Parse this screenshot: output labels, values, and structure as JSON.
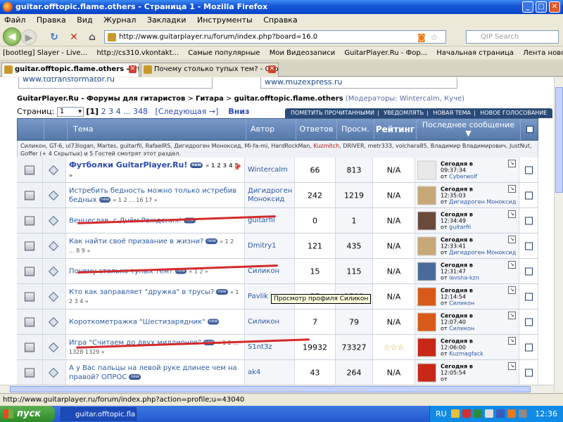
{
  "window": {
    "title": "guitar.offtopic.flame.others - Страница 1 - Mozilla Firefox"
  },
  "menu": [
    "Файл",
    "Правка",
    "Вид",
    "Журнал",
    "Закладки",
    "Инструменты",
    "Справка"
  ],
  "nav": {
    "url": "http://www.guitarplayer.ru/forum/index.php?board=16.0",
    "search_placeholder": "QIP Search"
  },
  "bookmarks": [
    "[bootleg] Slayer - Live...",
    "http://cs310.vkontakt...",
    "Самые популярные",
    "Мои Видеозаписи",
    "GuitarPlayer.Ru - Фор...",
    "Начальная страница",
    "Лента новостей"
  ],
  "tabs": [
    {
      "label": "guitar.offtopic.flame.others - Стр..."
    },
    {
      "label": "Почему столько тупых тем? - Страни..."
    }
  ],
  "ads": {
    "left": "www.tdtransformator.ru",
    "right": "www.muzexpress.ru"
  },
  "breadcrumb": {
    "site": "GuitarPlayer.Ru - Форумы для гитаристов",
    "sep1": " > ",
    "cat": "Гитара",
    "sep2": " > ",
    "board": "guitar.offtopic.flame.others",
    "mods_label": "(Модераторы:",
    "mods": "Wintercalm, Куче)"
  },
  "pager": {
    "label": "Страниц:",
    "select_value": "1",
    "current": "[1]",
    "pages": "2 3 4 ... 348",
    "next": "[Следующая →]",
    "bottom": "Вниз"
  },
  "actions": [
    "ПОМЕТИТЬ ПРОЧИТАННЫМИ",
    "УВЕДОМЛЯТЬ",
    "НОВАЯ ТЕМА",
    "НОВОЕ ГОЛОСОВАНИЕ"
  ],
  "table": {
    "headers": {
      "topic": "Тема",
      "author": "Автор",
      "replies": "Ответов",
      "views": "Просм.",
      "rating": "Рейтинг",
      "last": "Последнее сообщение"
    },
    "whoonline": {
      "text1": "Силикон, GT-6, ul73logan, Martes, guitarfil, RafaelRS, Дигидроген Моноксид, Mi-fa-mi, HardRockMan, ",
      "highlight": "Kuzmitch",
      "text2": ", DRIVER, metr333, volchara85, Владимир Владимирович, JustNut, Goffer (+ 4 Скрытых) и 5 Гостей смотрят этот раздел."
    },
    "rows": [
      {
        "topic": "Футболки GuitarPlayer.Ru!",
        "bold": true,
        "pages": "« 1 2 3 4 5 »",
        "author": "Wintercalm",
        "replies": "66",
        "views": "813",
        "rating": "N/A",
        "last_date": "Сегодня в",
        "last_time": "09:37:34",
        "last_from": "от",
        "last_user": "Cyberwolf",
        "avatar_color": "#e8e8e8"
      },
      {
        "topic": "Истребить бедность можно только истребив бедных",
        "bold": false,
        "pages": "« 1 2 ... 16 17 »",
        "author": "Дигидроген Моноксид",
        "replies": "242",
        "views": "1219",
        "rating": "N/A",
        "last_date": "Сегодня в",
        "last_time": "12:35:03",
        "last_from": "от",
        "last_user": "Дигидроген Моноксид",
        "avatar_color": "#c8a878"
      },
      {
        "topic": "Венцеслав, с Днём Рождения!",
        "bold": false,
        "pages": "",
        "author": "guitarfil",
        "replies": "0",
        "views": "1",
        "rating": "N/A",
        "last_date": "Сегодня в",
        "last_time": "12:34:49",
        "last_from": "от",
        "last_user": "guitarfil",
        "avatar_color": "#6a4a3a"
      },
      {
        "topic": "Как найти своё призвание в жизни?",
        "bold": false,
        "pages": "« 1 2 ... 8 9 »",
        "author": "Dmitry1",
        "replies": "121",
        "views": "435",
        "rating": "N/A",
        "last_date": "Сегодня в",
        "last_time": "12:33:41",
        "last_from": "от",
        "last_user": "Дигидроген Моноксид",
        "avatar_color": "#c8a878"
      },
      {
        "topic": "Почему столько тупых тем?",
        "bold": false,
        "pages": "« 1 2 »",
        "author": "Силикон",
        "replies": "15",
        "views": "115",
        "rating": "N/A",
        "last_date": "Сегодня в",
        "last_time": "12:31:47",
        "last_from": "от",
        "last_user": "levsha-kzn",
        "avatar_color": "#4a6a9a"
      },
      {
        "topic": "Кто как заправляет \"дружка\" в трусы?",
        "bold": false,
        "pages": "« 1 2 3 4 »",
        "author": "Pavlik",
        "replies": "57",
        "views": "1523",
        "rating": "N/A",
        "last_date": "Сегодня в",
        "last_time": "12:14:54",
        "last_from": "от",
        "last_user": "Силикон",
        "avatar_color": "#d85a18"
      },
      {
        "topic": "Короткометражка \"Шестизарядник\"",
        "bold": false,
        "pages": "",
        "author": "Силикон",
        "replies": "7",
        "views": "79",
        "rating": "N/A",
        "last_date": "Сегодня в",
        "last_time": "12:07:40",
        "last_from": "от",
        "last_user": "Силикон",
        "avatar_color": "#d85a18"
      },
      {
        "topic": "Игра \"Считаем до двух миллионов\"",
        "bold": false,
        "pages": "« 1 2 ... 1328 1329 »",
        "author": "S1nt3z",
        "replies": "19932",
        "views": "73327",
        "rating": "☆☆☆",
        "last_date": "Сегодня в",
        "last_time": "12:06:00",
        "last_from": "от",
        "last_user": "Kuzmagfack",
        "avatar_color": "#c82818"
      },
      {
        "topic": "А у Вас пальцы на левой руке длинее чем на правой? ОПРОС",
        "bold": false,
        "pages": "",
        "author": "ak4",
        "replies": "43",
        "views": "264",
        "rating": "N/A",
        "last_date": "Сегодня в",
        "last_time": "12:05:54",
        "last_from": "от",
        "last_user": "",
        "avatar_color": "#c82818"
      }
    ]
  },
  "tooltip": "Просмотр профиля Силикон",
  "status": "http://www.guitarplayer.ru/forum/index.php?action=profile;u=43040",
  "taskbar": {
    "start": "пуск",
    "item": "guitar.offtopic.flame...",
    "lang": "RU",
    "clock": "12:36"
  },
  "colors": {
    "header_blue": "#5678aa",
    "link": "#2a5aa0",
    "red_highlight": "#d42a2a"
  }
}
